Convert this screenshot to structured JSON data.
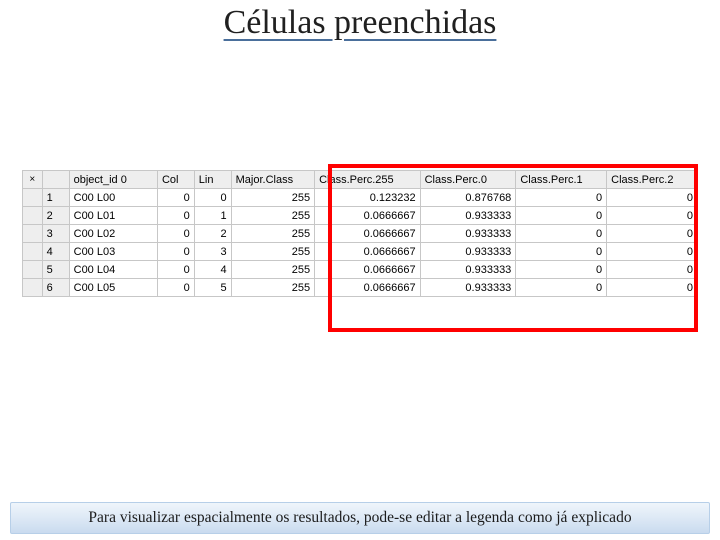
{
  "title": "Células preenchidas",
  "close_glyph": "×",
  "table": {
    "headers": {
      "object_id": "object_id 0",
      "col": "Col",
      "lin": "Lin",
      "major_class": "Major.Class",
      "p255": "Class.Perc.255",
      "p0": "Class.Perc.0",
      "p1": "Class.Perc.1",
      "p2": "Class.Perc.2"
    },
    "rows": [
      {
        "n": "1",
        "obj": "C00 L00",
        "col": "0",
        "lin": "0",
        "major": "255",
        "p255": "0.123232",
        "p0": "0.876768",
        "p1": "0",
        "p2": "0"
      },
      {
        "n": "2",
        "obj": "C00 L01",
        "col": "0",
        "lin": "1",
        "major": "255",
        "p255": "0.0666667",
        "p0": "0.933333",
        "p1": "0",
        "p2": "0"
      },
      {
        "n": "3",
        "obj": "C00 L02",
        "col": "0",
        "lin": "2",
        "major": "255",
        "p255": "0.0666667",
        "p0": "0.933333",
        "p1": "0",
        "p2": "0"
      },
      {
        "n": "4",
        "obj": "C00 L03",
        "col": "0",
        "lin": "3",
        "major": "255",
        "p255": "0.0666667",
        "p0": "0.933333",
        "p1": "0",
        "p2": "0"
      },
      {
        "n": "5",
        "obj": "C00 L04",
        "col": "0",
        "lin": "4",
        "major": "255",
        "p255": "0.0666667",
        "p0": "0.933333",
        "p1": "0",
        "p2": "0"
      },
      {
        "n": "6",
        "obj": "C00 L05",
        "col": "0",
        "lin": "5",
        "major": "255",
        "p255": "0.0666667",
        "p0": "0.933333",
        "p1": "0",
        "p2": "0"
      }
    ]
  },
  "footer": "Para  visualizar espacialmente os resultados, pode-se editar a legenda como já explicado"
}
